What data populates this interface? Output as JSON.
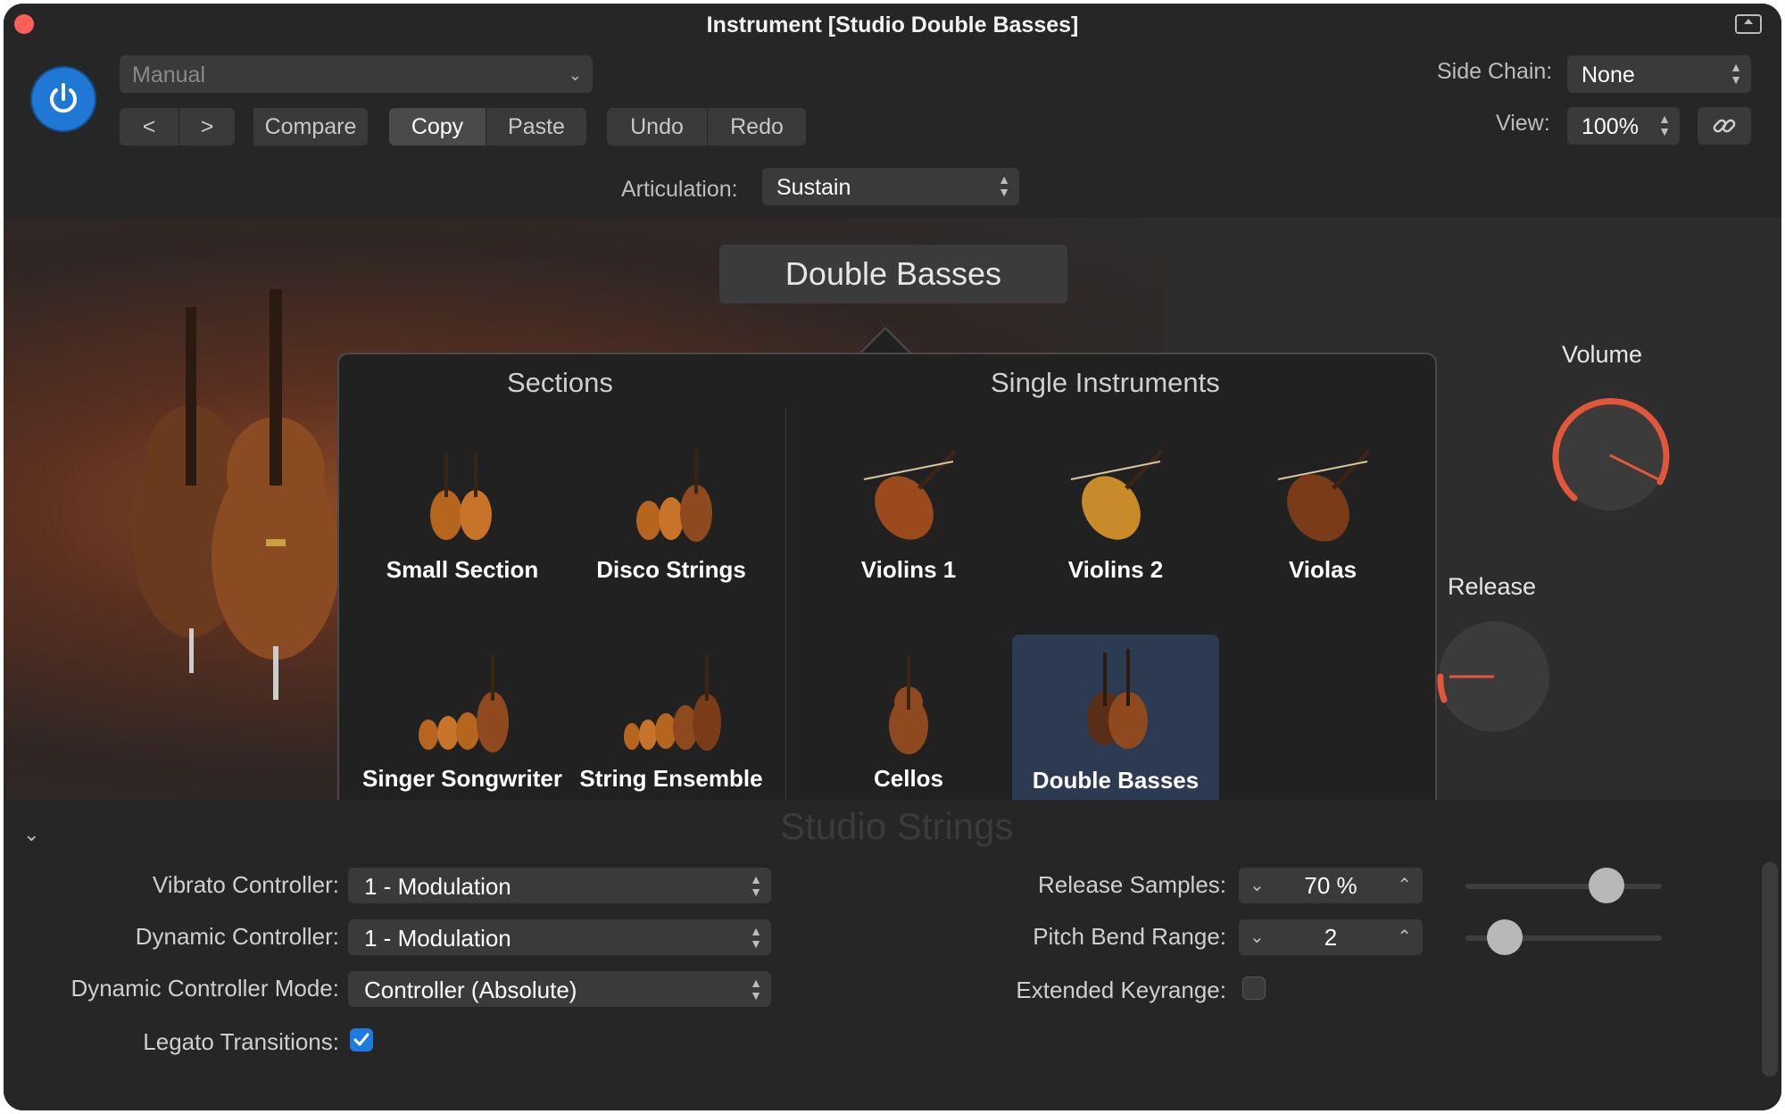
{
  "window": {
    "title": "Instrument [Studio Double Basses]"
  },
  "header": {
    "preset": "Manual",
    "nav_prev": "<",
    "nav_next": ">",
    "compare": "Compare",
    "copy": "Copy",
    "paste": "Paste",
    "undo": "Undo",
    "redo": "Redo",
    "side_chain_label": "Side Chain:",
    "side_chain_value": "None",
    "view_label": "View:",
    "view_value": "100%",
    "articulation_label": "Articulation:",
    "articulation_value": "Sustain"
  },
  "panel": {
    "instrument_button": "Double Basses",
    "volume_label": "Volume",
    "release_label": "Release",
    "accent_color": "#e2563a"
  },
  "popup": {
    "sections_header": "Sections",
    "single_header": "Single Instruments",
    "sections": [
      {
        "name": "Small Section",
        "icon": "violin-duo-icon"
      },
      {
        "name": "Disco Strings",
        "icon": "violin-trio-icon"
      },
      {
        "name": "Singer Songwriter",
        "icon": "string-quartet-icon"
      },
      {
        "name": "String Ensemble",
        "icon": "string-ensemble-icon"
      }
    ],
    "singles": [
      {
        "name": "Violins 1",
        "icon": "violin-icon"
      },
      {
        "name": "Violins 2",
        "icon": "violin-icon"
      },
      {
        "name": "Violas",
        "icon": "viola-icon"
      },
      {
        "name": "Cellos",
        "icon": "cello-icon"
      },
      {
        "name": "Double Basses",
        "icon": "double-bass-icon",
        "selected": true
      }
    ]
  },
  "bottom": {
    "studio_label": "Studio Strings",
    "vibrato_label": "Vibrato Controller:",
    "vibrato_value": "1 - Modulation",
    "dynamic_label": "Dynamic Controller:",
    "dynamic_value": "1 - Modulation",
    "dyn_mode_label": "Dynamic Controller Mode:",
    "dyn_mode_value": "Controller (Absolute)",
    "legato_label": "Legato Transitions:",
    "legato_checked": true,
    "release_samples_label": "Release Samples:",
    "release_samples_value": "70 %",
    "release_samples_fraction": 0.72,
    "pitch_bend_label": "Pitch Bend Range:",
    "pitch_bend_value": "2",
    "pitch_bend_fraction": 0.2,
    "extended_label": "Extended Keyrange:",
    "extended_checked": false
  }
}
